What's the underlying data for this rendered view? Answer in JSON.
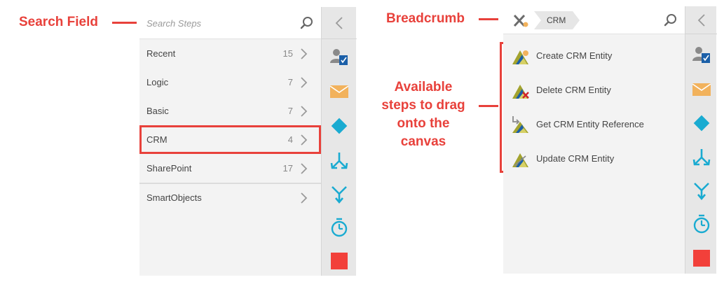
{
  "annotations": {
    "search_field": "Search Field",
    "breadcrumb": "Breadcrumb",
    "steps": [
      "Available",
      "steps to drag",
      "onto the",
      "canvas"
    ]
  },
  "left_panel": {
    "search": {
      "placeholder": "Search Steps",
      "value": ""
    },
    "categories": [
      {
        "label": "Recent",
        "count": "15"
      },
      {
        "label": "Logic",
        "count": "7"
      },
      {
        "label": "Basic",
        "count": "7"
      },
      {
        "label": "CRM",
        "count": "4",
        "selected": true
      },
      {
        "label": "SharePoint",
        "count": "17"
      },
      {
        "label": "SmartObjects",
        "count": ""
      }
    ]
  },
  "right_panel": {
    "breadcrumb": {
      "home_icon": "tools-icon",
      "current": "CRM"
    },
    "steps": [
      {
        "label": "Create CRM Entity",
        "icon": "crm-create-icon"
      },
      {
        "label": "Delete CRM Entity",
        "icon": "crm-delete-icon"
      },
      {
        "label": "Get CRM Entity Reference",
        "icon": "crm-reference-icon"
      },
      {
        "label": "Update CRM Entity",
        "icon": "crm-update-icon"
      }
    ]
  },
  "toolbar": {
    "collapse_icon": "chevron-left-icon",
    "items": [
      "user-task-icon",
      "email-icon",
      "decision-icon",
      "split-icon",
      "merge-icon",
      "timer-icon",
      "stop-icon"
    ]
  },
  "colors": {
    "annotation": "#e8413b",
    "toolbar_teal": "#1aabd1",
    "email": "#f2b25c",
    "stop": "#f2403a",
    "crm_olive": "#a3a32e",
    "crm_blue": "#1b5fa8"
  }
}
